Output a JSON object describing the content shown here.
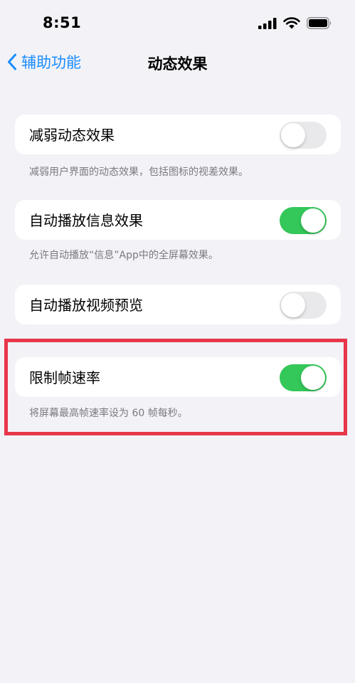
{
  "status_bar": {
    "time": "8:51",
    "icons": [
      "cellular-signal-icon",
      "wifi-icon",
      "battery-icon"
    ]
  },
  "nav": {
    "back_label": "辅助功能",
    "title": "动态效果"
  },
  "settings": [
    {
      "label": "减弱动态效果",
      "enabled": false,
      "footnote": "减弱用户界面的动态效果，包括图标的视差效果。"
    },
    {
      "label": "自动播放信息效果",
      "enabled": true,
      "footnote": "允许自动播放“信息”App中的全屏幕效果。"
    },
    {
      "label": "自动播放视频预览",
      "enabled": false,
      "footnote": ""
    },
    {
      "label": "限制帧速率",
      "enabled": true,
      "footnote": "将屏幕最高帧速率设为 60 帧每秒。"
    }
  ],
  "colors": {
    "background": "#f2f2f7",
    "accent_blue": "#1a8dfe",
    "toggle_on": "#34c759",
    "toggle_off": "#e9e9eb",
    "highlight_border": "#e8364a"
  }
}
